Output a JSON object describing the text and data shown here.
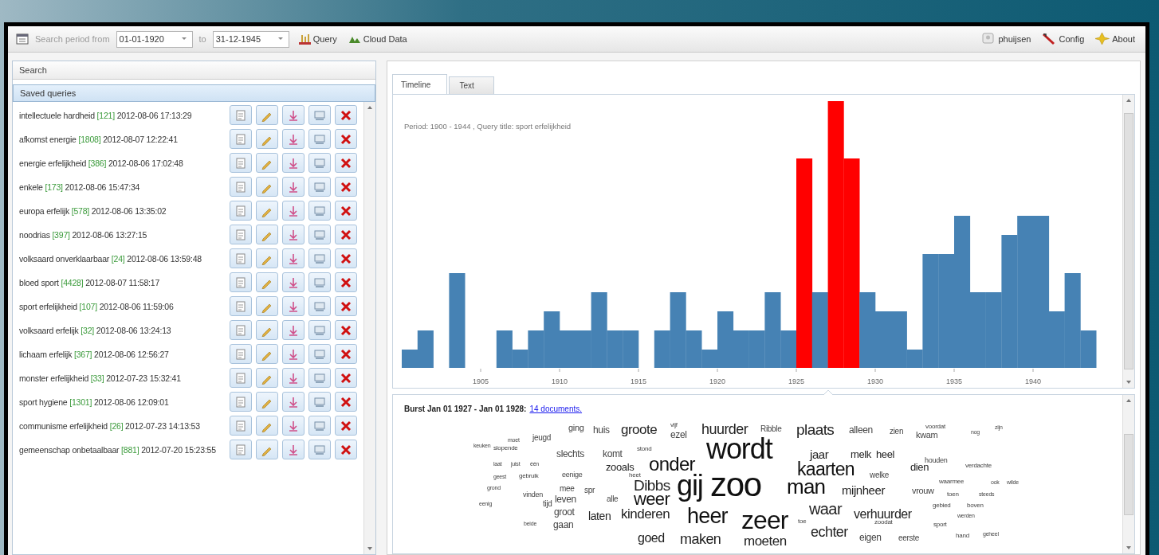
{
  "toolbar": {
    "period_label": "Search period from",
    "from_date": "01-01-1920",
    "to_label": "to",
    "to_date": "31-12-1945",
    "buttons": [
      {
        "kind": "query",
        "label": "Query"
      },
      {
        "kind": "cloud",
        "label": "Cloud Data"
      }
    ],
    "right_buttons": [
      {
        "kind": "user",
        "label": "phuijsen"
      },
      {
        "kind": "config",
        "label": "Config"
      },
      {
        "kind": "about",
        "label": "About"
      }
    ]
  },
  "left_panel": {
    "search_header": "Search",
    "saved_header": "Saved queries",
    "queries": [
      {
        "name": "intellectuele hardheid",
        "count": "[121]",
        "date": "2012-08-06 17:13:29"
      },
      {
        "name": "afkomst energie",
        "count": "[1808]",
        "date": "2012-08-07 12:22:41"
      },
      {
        "name": "energie erfelijkheid",
        "count": "[386]",
        "date": "2012-08-06 17:02:48"
      },
      {
        "name": "enkele",
        "count": "[173]",
        "date": "2012-08-06 15:47:34"
      },
      {
        "name": "europa erfelijk",
        "count": "[578]",
        "date": "2012-08-06 13:35:02"
      },
      {
        "name": "noodrias",
        "count": "[397]",
        "date": "2012-08-06 13:27:15"
      },
      {
        "name": "volksaard onverklaarbaar",
        "count": "[24]",
        "date": "2012-08-06 13:59:48"
      },
      {
        "name": "bloed sport",
        "count": "[4428]",
        "date": "2012-08-07 11:58:17"
      },
      {
        "name": "sport erfelijkheid",
        "count": "[107]",
        "date": "2012-08-06 11:59:06"
      },
      {
        "name": "volksaard erfelijk",
        "count": "[32]",
        "date": "2012-08-06 13:24:13"
      },
      {
        "name": "lichaam erfelijk",
        "count": "[367]",
        "date": "2012-08-06 12:56:27"
      },
      {
        "name": "monster erfelijkheid",
        "count": "[33]",
        "date": "2012-07-23 15:32:41"
      },
      {
        "name": "sport hygiene",
        "count": "[1301]",
        "date": "2012-08-06 12:09:01"
      },
      {
        "name": "communisme erfelijkheid",
        "count": "[26]",
        "date": "2012-07-23 14:13:53"
      },
      {
        "name": "gemeenschap onbetaalbaar",
        "count": "[881]",
        "date": "2012-07-20 15:23:55"
      }
    ]
  },
  "tabs": [
    {
      "label": "Timeline",
      "selected": true
    },
    {
      "label": "Text",
      "selected": false
    }
  ],
  "timeline": {
    "caption": "Period: 1900 - 1944 , Query title: sport erfelijkheid",
    "x_tick_labels": [
      "1905",
      "1910",
      "1915",
      "1920",
      "1925",
      "1930",
      "1935",
      "1940"
    ]
  },
  "burst": {
    "title": "Burst Jan 01 1927 - Jan 01 1928:",
    "link": "14 documents.",
    "words": [
      "ging",
      "huis",
      "groote",
      "vijf",
      "ezel",
      "huurder",
      "Ribble",
      "plaats",
      "alleen",
      "zien",
      "voordat",
      "kwam",
      "nog",
      "zijn",
      "moet",
      "jeugd",
      "keuken",
      "slopende",
      "slechts",
      "komt",
      "stond",
      "wordt",
      "jaar",
      "melk",
      "heel",
      "houden",
      "laat",
      "juist",
      "één",
      "zooals",
      "onder",
      "kaarten",
      "welke",
      "dien",
      "verdachte",
      "geest",
      "gebruik",
      "eenige",
      "heet",
      "Dibbs",
      "gij",
      "zoo",
      "man",
      "mijnheer",
      "waarmee",
      "ook",
      "wilde",
      "vrouw",
      "toen",
      "steeds",
      "grond",
      "vinden",
      "mee",
      "spr",
      "leven",
      "alle",
      "weer",
      "eenig",
      "tijd",
      "groot",
      "laten",
      "kinderen",
      "heer",
      "zeer",
      "toe",
      "waar",
      "verhuurder",
      "gebied",
      "boven",
      "werden",
      "sport",
      "zoodat",
      "echter",
      "eigen",
      "eerste",
      "hand",
      "geheel",
      "beide",
      "gaan",
      "goed",
      "maken",
      "moeten"
    ]
  }
}
